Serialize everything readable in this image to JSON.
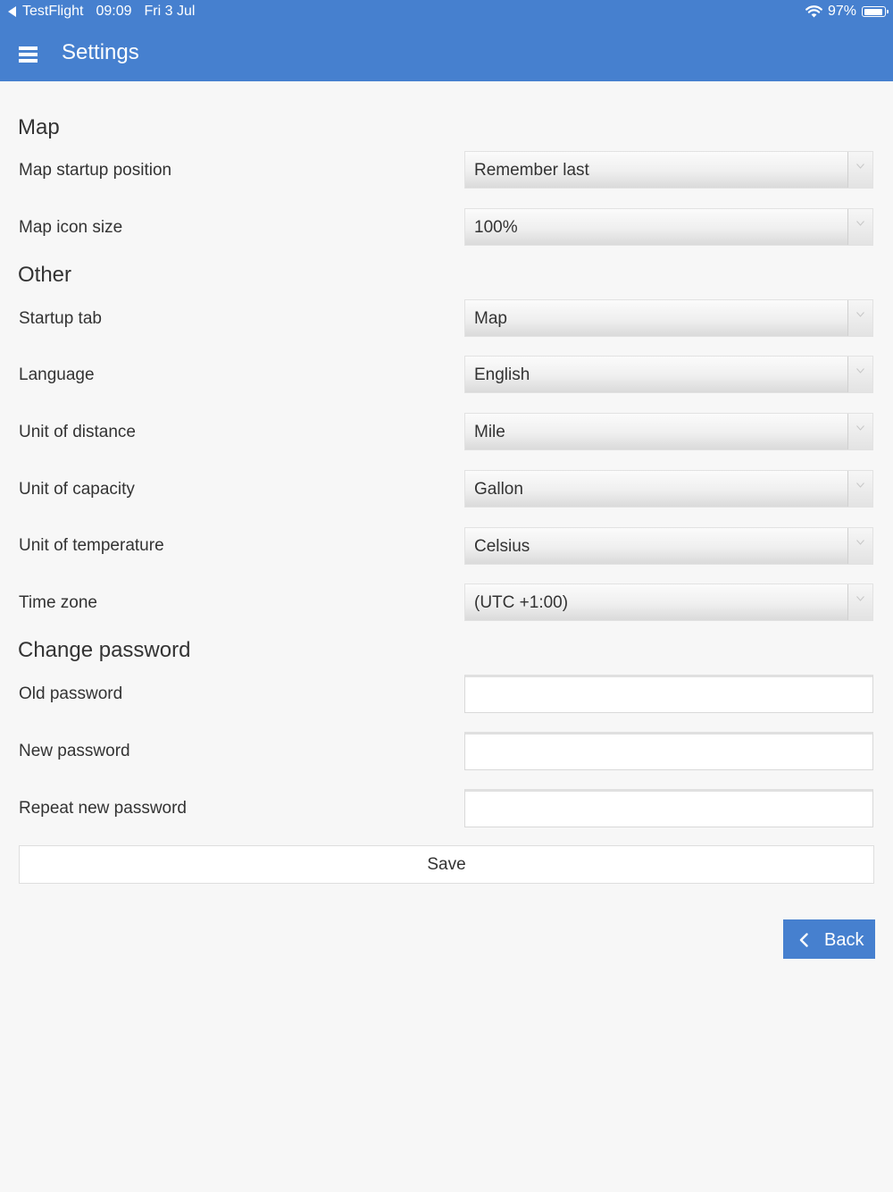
{
  "status_bar": {
    "app": "TestFlight",
    "time": "09:09",
    "date": "Fri 3 Jul",
    "battery": "97%",
    "battery_level": 0.97
  },
  "header": {
    "title": "Settings",
    "background": "#4680cf"
  },
  "sections": {
    "map": {
      "title": "Map",
      "startup_position": {
        "label": "Map startup position",
        "value": "Remember last"
      },
      "icon_size": {
        "label": "Map icon size",
        "value": "100%"
      }
    },
    "other": {
      "title": "Other",
      "startup_tab": {
        "label": "Startup tab",
        "value": "Map"
      },
      "language": {
        "label": "Language",
        "value": "English"
      },
      "unit_distance": {
        "label": "Unit of distance",
        "value": "Mile"
      },
      "unit_capacity": {
        "label": "Unit of capacity",
        "value": "Gallon"
      },
      "unit_temperature": {
        "label": "Unit of temperature",
        "value": "Celsius"
      },
      "time_zone": {
        "label": "Time zone",
        "value": "(UTC +1:00)"
      }
    },
    "password": {
      "title": "Change password",
      "old": {
        "label": "Old password",
        "value": ""
      },
      "new": {
        "label": "New password",
        "value": ""
      },
      "repeat": {
        "label": "Repeat new password",
        "value": ""
      }
    }
  },
  "actions": {
    "save_label": "Save",
    "back_label": "Back"
  },
  "icons": {
    "menu": "hamburger-menu-icon",
    "back": "chevron-left-icon",
    "dropdown": "chevron-down-icon",
    "wifi": "wifi-icon",
    "battery": "battery-icon"
  }
}
